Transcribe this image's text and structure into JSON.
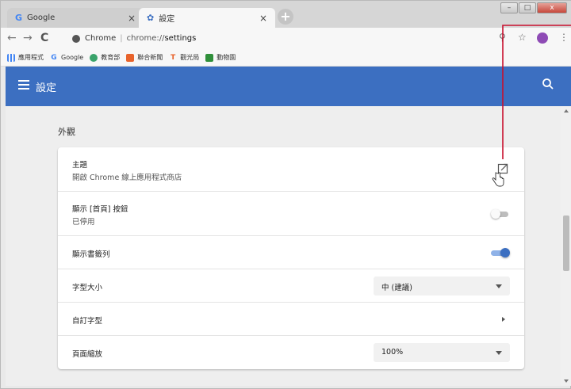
{
  "tabs": [
    {
      "favicon": "G",
      "title": "Google",
      "close": "×"
    },
    {
      "favicon": "✿",
      "title": "設定",
      "close": "×"
    }
  ],
  "new_tab_label": "+",
  "window_controls": {
    "minimize": "–",
    "maximize": "□",
    "close": "x"
  },
  "toolbar": {
    "back": "←",
    "forward": "→",
    "reload": "C",
    "site_name": "Chrome",
    "url_scheme": "chrome://",
    "url_path": "settings",
    "zoom_icon": "⚲",
    "star": "☆",
    "menu": "⋮"
  },
  "bookmarks": [
    {
      "icon": "apps-icon",
      "label": "應用程式"
    },
    {
      "icon": "google-icon",
      "label": "Google"
    },
    {
      "icon": "ministry-icon",
      "label": "教育部"
    },
    {
      "icon": "news-icon",
      "label": "聯合新聞"
    },
    {
      "icon": "tourism-icon",
      "label": "觀光局"
    },
    {
      "icon": "zoo-icon",
      "label": "動物園"
    }
  ],
  "settings": {
    "title": "設定",
    "section_title": "外觀",
    "rows": [
      {
        "label": "主題",
        "sub": "開啟 Chrome 線上應用程式商店",
        "control": "external-link"
      },
      {
        "label": "顯示 [首頁] 按鈕",
        "sub": "已停用",
        "control": "toggle",
        "state": "off"
      },
      {
        "label": "顯示書籤列",
        "control": "toggle",
        "state": "on"
      },
      {
        "label": "字型大小",
        "control": "select",
        "value": "中 (建議)"
      },
      {
        "label": "自訂字型",
        "control": "arrow"
      },
      {
        "label": "頁面縮放",
        "control": "select",
        "value": "100%"
      }
    ]
  },
  "colors": {
    "accent": "#3c6fc1",
    "callout": "#c8102e"
  }
}
